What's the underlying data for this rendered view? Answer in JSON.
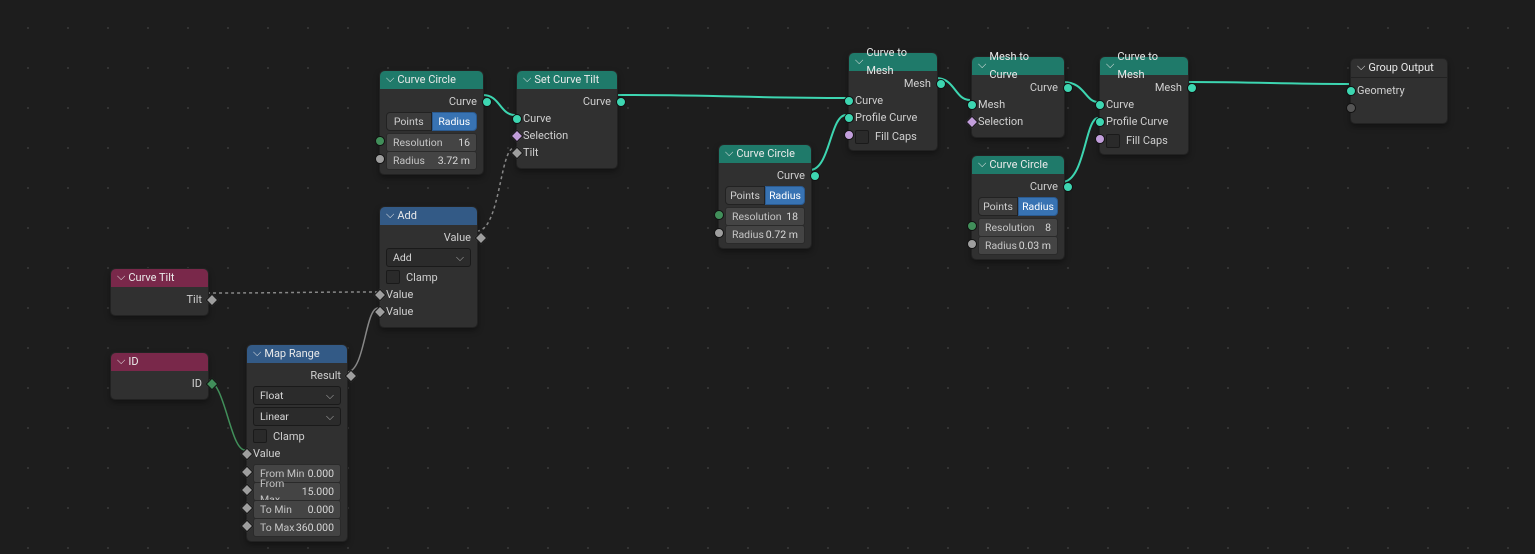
{
  "nodes": {
    "curve_tilt": {
      "title": "Curve Tilt",
      "out": "Tilt"
    },
    "id": {
      "title": "ID",
      "out": "ID"
    },
    "map_range": {
      "title": "Map Range",
      "out": "Result",
      "type": "Float",
      "interp": "Linear",
      "clamp": "Clamp",
      "value": "Value",
      "from_min": {
        "label": "From Min",
        "value": "0.000"
      },
      "from_max": {
        "label": "From Max",
        "value": "15.000"
      },
      "to_min": {
        "label": "To Min",
        "value": "0.000"
      },
      "to_max": {
        "label": "To Max",
        "value": "360.000"
      }
    },
    "add": {
      "title": "Add",
      "out": "Value",
      "op": "Add",
      "clamp": "Clamp",
      "value1": "Value",
      "value2": "Value"
    },
    "cc1": {
      "title": "Curve Circle",
      "out": "Curve",
      "modeA": "Points",
      "modeB": "Radius",
      "resolution": {
        "label": "Resolution",
        "value": "16"
      },
      "radius": {
        "label": "Radius",
        "value": "3.72 m"
      }
    },
    "sct": {
      "title": "Set Curve Tilt",
      "out": "Curve",
      "curve": "Curve",
      "selection": "Selection",
      "tilt": "Tilt"
    },
    "cc2": {
      "title": "Curve Circle",
      "out": "Curve",
      "modeA": "Points",
      "modeB": "Radius",
      "resolution": {
        "label": "Resolution",
        "value": "18"
      },
      "radius": {
        "label": "Radius",
        "value": "0.72 m"
      }
    },
    "ctm1": {
      "title": "Curve to Mesh",
      "out": "Mesh",
      "curve": "Curve",
      "profile": "Profile Curve",
      "fill": "Fill Caps"
    },
    "mtc": {
      "title": "Mesh to Curve",
      "out": "Curve",
      "mesh": "Mesh",
      "selection": "Selection"
    },
    "cc3": {
      "title": "Curve Circle",
      "out": "Curve",
      "modeA": "Points",
      "modeB": "Radius",
      "resolution": {
        "label": "Resolution",
        "value": "8"
      },
      "radius": {
        "label": "Radius",
        "value": "0.03 m"
      }
    },
    "ctm2": {
      "title": "Curve to Mesh",
      "out": "Mesh",
      "curve": "Curve",
      "profile": "Profile Curve",
      "fill": "Fill Caps"
    },
    "gout": {
      "title": "Group Output",
      "geometry": "Geometry"
    }
  }
}
